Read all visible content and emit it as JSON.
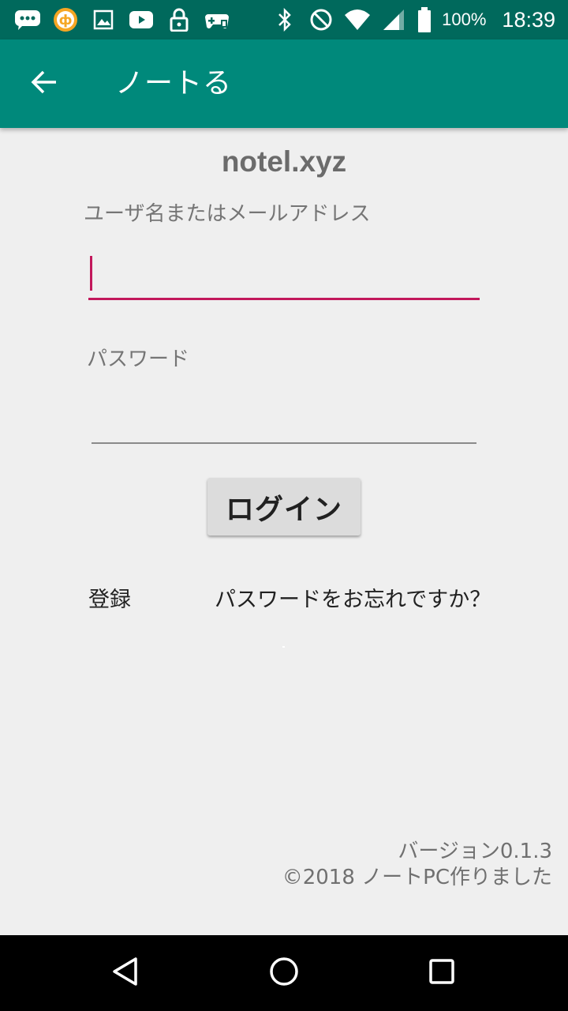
{
  "status_bar": {
    "battery_percent": "100%",
    "time": "18:39",
    "icons": [
      "sms-icon",
      "app-notification-icon",
      "image-icon",
      "youtube-icon",
      "lock-icon",
      "game-controller-icon",
      "bluetooth-icon",
      "do-not-disturb-icon",
      "wifi-icon",
      "cell-signal-icon",
      "battery-icon"
    ]
  },
  "app_bar": {
    "title": "ノートる",
    "back_icon": "arrow-back-icon",
    "color": "#00897b"
  },
  "login": {
    "site_title": "notel.xyz",
    "username_label": "ユーザ名またはメールアドレス",
    "username_value": "",
    "password_label": "パスワード",
    "password_value": "",
    "login_button": "ログイン",
    "register_link": "登録",
    "forgot_link": "パスワードをお忘れですか？",
    "accent_color": "#c2185b"
  },
  "footer": {
    "version": "バージョン0.1.3",
    "copyright": "©2018 ノートPC作りました"
  },
  "nav_bar": {
    "icons": [
      "nav-back-icon",
      "nav-home-icon",
      "nav-recents-icon"
    ]
  }
}
